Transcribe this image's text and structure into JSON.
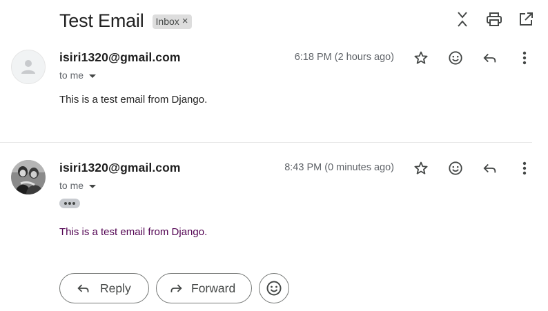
{
  "thread": {
    "subject": "Test Email",
    "label": "Inbox",
    "label_remove_glyph": "×"
  },
  "top_actions": [
    "collapse-all-icon",
    "print-icon",
    "open-in-new-window-icon"
  ],
  "messages": [
    {
      "sender": "isiri1320@gmail.com",
      "recipient_summary": "to me",
      "timestamp": "6:18 PM (2 hours ago)",
      "avatar": "default-person-icon",
      "body": "This is a test email from Django.",
      "actions": [
        "star-icon",
        "emoji-reaction-icon",
        "reply-icon",
        "more-options-icon"
      ]
    },
    {
      "sender": "isiri1320@gmail.com",
      "recipient_summary": "to me",
      "timestamp": "8:43 PM (0 minutes ago)",
      "avatar": "profile-photo",
      "body": "This is a test email from Django.",
      "trimmed_content_indicator": "•••",
      "actions": [
        "star-icon",
        "emoji-reaction-icon",
        "reply-icon",
        "more-options-icon"
      ]
    }
  ],
  "footer": {
    "reply_label": "Reply",
    "forward_label": "Forward",
    "emoji_icon": "emoji-reaction-icon"
  },
  "colors": {
    "text_primary": "#1f1f1f",
    "text_secondary": "#5f6368",
    "quoted_text": "#500050",
    "chip_bg": "#dddddd",
    "divider": "#e6e6e6"
  }
}
